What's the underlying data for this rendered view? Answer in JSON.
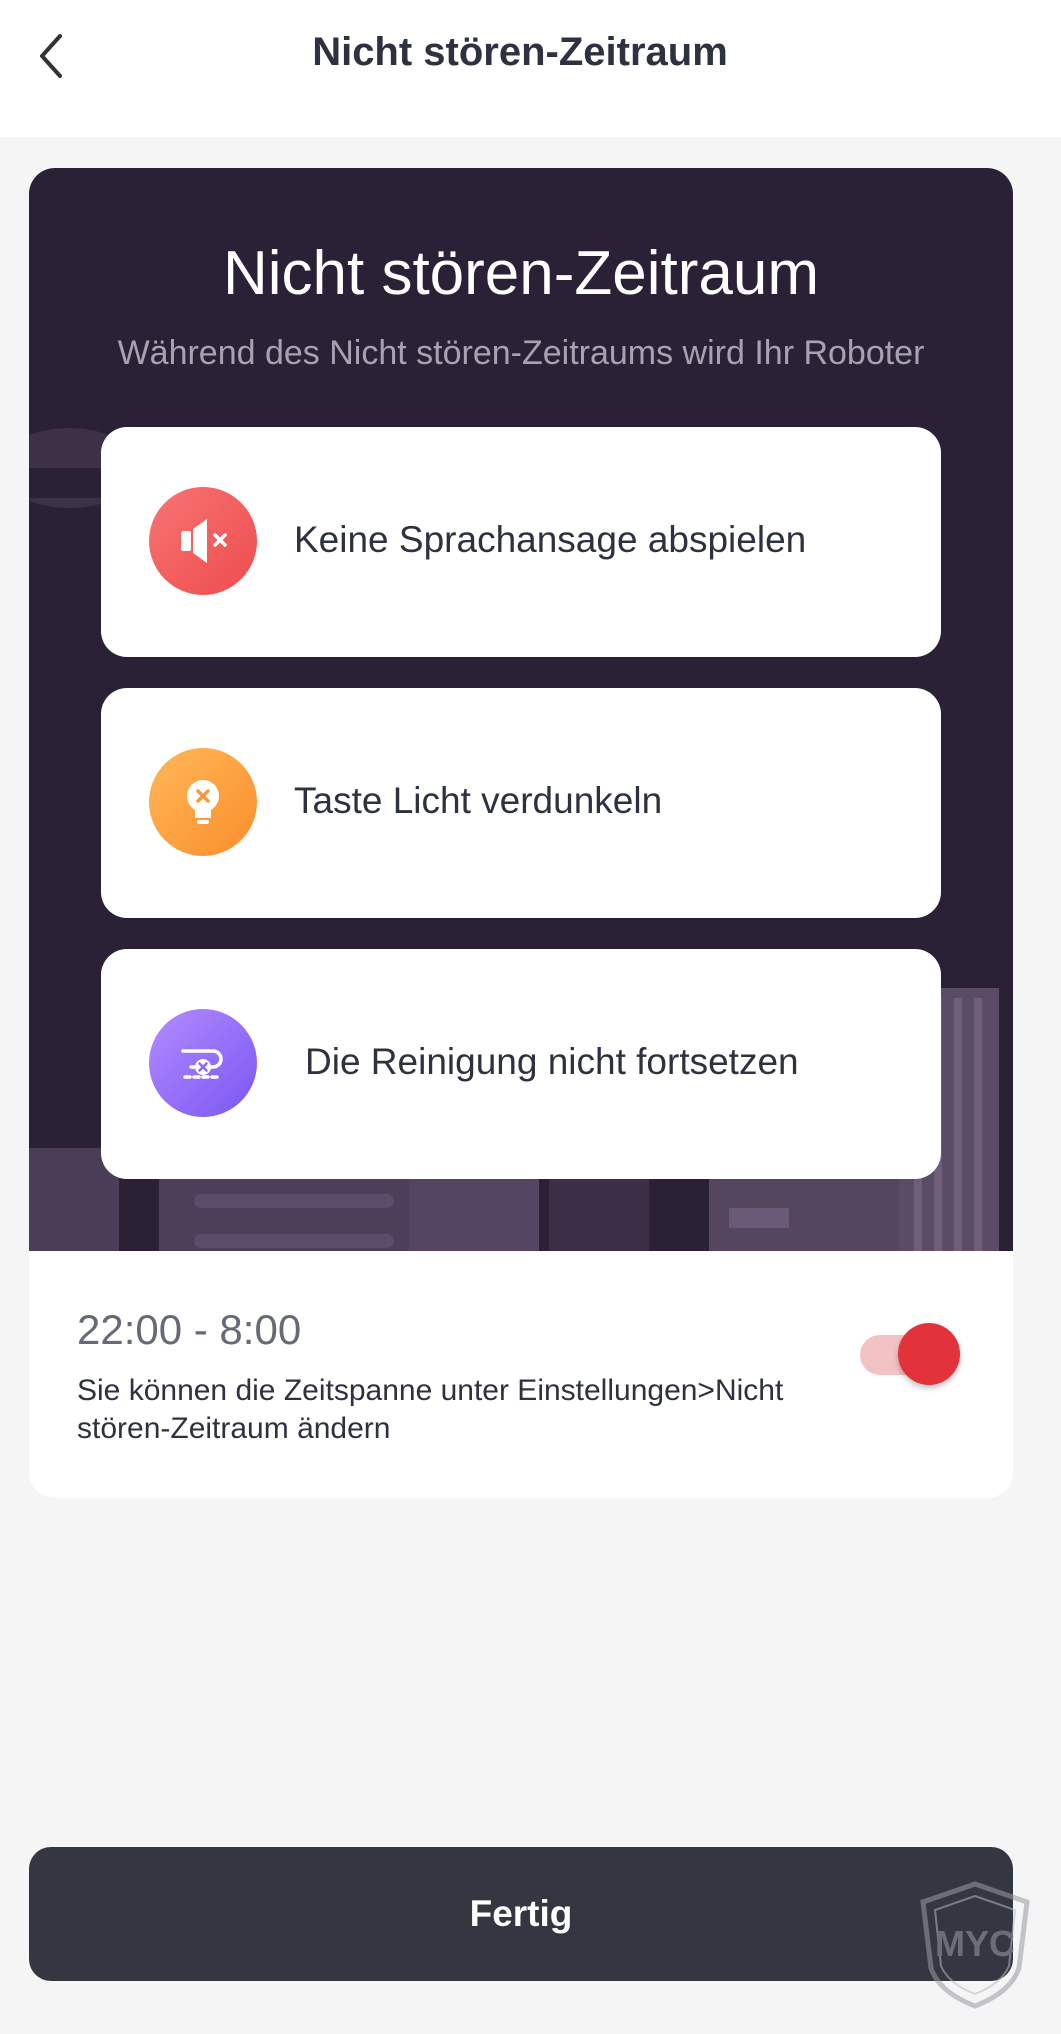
{
  "header": {
    "title": "Nicht stören-Zeitraum",
    "back_icon": "chevron-left-icon"
  },
  "hero": {
    "title": "Nicht stören-Zeitraum",
    "subtitle": "Während des Nicht stören-Zeitraums wird Ihr Roboter",
    "background_color": "#2b2137",
    "features": [
      {
        "label": "Keine Sprachansage abspielen",
        "icon": "speaker-muted-icon",
        "color": "#f05a5a"
      },
      {
        "label": "Taste Licht verdunkeln",
        "icon": "lightbulb-off-icon",
        "color": "#fb9a3a"
      },
      {
        "label": "Die Reinigung nicht fortsetzen",
        "icon": "route-cancel-icon",
        "color": "#8f66f7"
      }
    ]
  },
  "schedule": {
    "time_range": "22:00 - 8:00",
    "hint": "Sie können die Zeitspanne unter Einstellungen>Nicht stören-Zeitraum ändern",
    "toggle_on": true,
    "toggle_color": "#e2323a"
  },
  "footer": {
    "done_label": "Fertig",
    "button_color": "#343642"
  },
  "watermark": {
    "text": "MYC",
    "icon": "shield-logo-icon"
  }
}
